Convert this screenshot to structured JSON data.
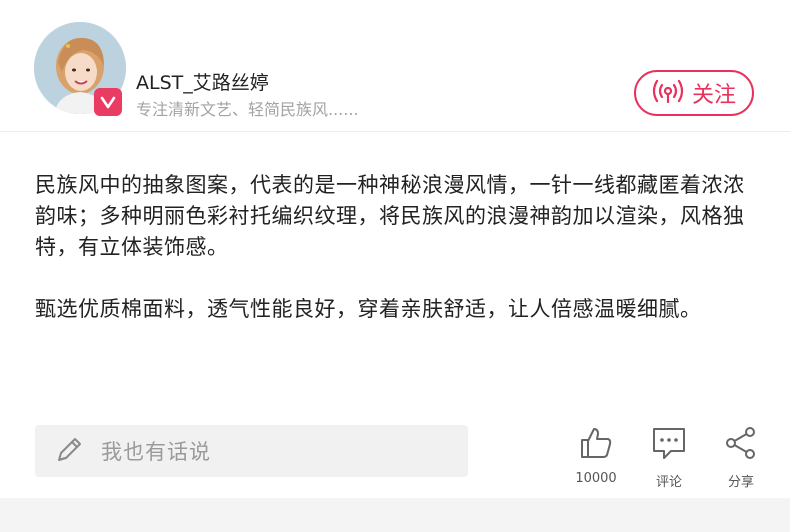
{
  "user": {
    "name": "ALST_艾路丝婷",
    "description": "专注清新文艺、轻简民族风......",
    "badge_icon": "vip-badge-icon"
  },
  "follow": {
    "label": "关注",
    "icon": "live-broadcast-icon",
    "color": "#e8315c"
  },
  "content": {
    "paragraphs": [
      "民族风中的抽象图案，代表的是一种神秘浪漫风情，一针一线都藏匿着浓浓韵味；多种明丽色彩衬托编织纹理，将民族风的浪漫神韵加以渲染，风格独特，有立体装饰感。",
      "甄选优质棉面料，透气性能良好，穿着亲肤舒适，让人倍感温暖细腻。"
    ]
  },
  "footer": {
    "comment_placeholder": "我也有话说",
    "like_count": "10000",
    "comment_label": "评论",
    "share_label": "分享"
  },
  "colors": {
    "accent": "#e8315c",
    "badge": "#ea3b63",
    "muted": "#a3a3a3"
  }
}
